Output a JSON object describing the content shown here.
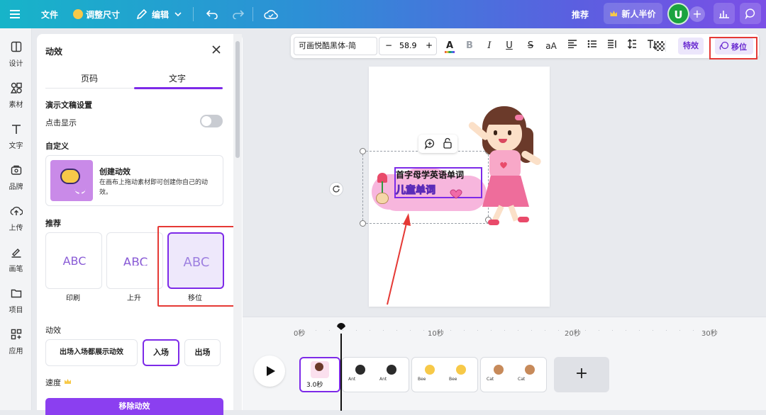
{
  "topbar": {
    "menu_file": "文件",
    "resize": "调整尺寸",
    "edit": "编辑",
    "recommend": "推荐",
    "new_user_offer": "新人半价",
    "avatar_letter": "U"
  },
  "rail": [
    {
      "label": "设计",
      "icon": "layout-icon"
    },
    {
      "label": "素材",
      "icon": "elements-icon"
    },
    {
      "label": "文字",
      "icon": "text-icon"
    },
    {
      "label": "品牌",
      "icon": "brand-icon"
    },
    {
      "label": "上传",
      "icon": "upload-icon"
    },
    {
      "label": "画笔",
      "icon": "pen-icon"
    },
    {
      "label": "项目",
      "icon": "folder-icon"
    },
    {
      "label": "应用",
      "icon": "apps-icon"
    }
  ],
  "panel": {
    "title": "动效",
    "tabs": [
      "页码",
      "文字"
    ],
    "active_tab": "文字",
    "present_section": "演示文稿设置",
    "click_show": "点击显示",
    "custom_section": "自定义",
    "create_title": "创建动效",
    "create_desc": "在画布上拖动素材即可创建你自己的动效。",
    "recommend_section": "推荐",
    "effects": [
      {
        "label": "印刷",
        "preview": "ABC"
      },
      {
        "label": "上升",
        "preview": "ABC"
      },
      {
        "label": "移位",
        "preview": "ABC"
      }
    ],
    "selected_effect": "移位",
    "anim_section": "动效",
    "anim_buttons": [
      "出场入场都展示动效",
      "入场",
      "出场"
    ],
    "anim_active": "入场",
    "speed_label": "速度",
    "remove_button": "移除动效"
  },
  "toolbar": {
    "font_name": "可画悦酷黑体-简",
    "font_size": "58.9",
    "effects_label": "特效",
    "animate_label": "移位",
    "minus": "−",
    "plus": "+",
    "bold": "B",
    "italic": "I",
    "underline": "U",
    "strike": "S",
    "case": "aA"
  },
  "canvas": {
    "line1": "首字母学英语单词",
    "line2": "儿童单词"
  },
  "timeline": {
    "ticks": [
      "0秒",
      "10秒",
      "20秒",
      "30秒"
    ],
    "first_clip_duration": "3.0秒",
    "clip_texts": [
      [
        "Ant",
        "Ant"
      ],
      [
        "Bee",
        "Bee"
      ],
      [
        "Cat",
        "Cat"
      ]
    ],
    "add_label": "+"
  },
  "colors": {
    "accent": "#7d2ae8",
    "highlight_red": "#e53935",
    "avatar_green": "#1aa33f"
  }
}
